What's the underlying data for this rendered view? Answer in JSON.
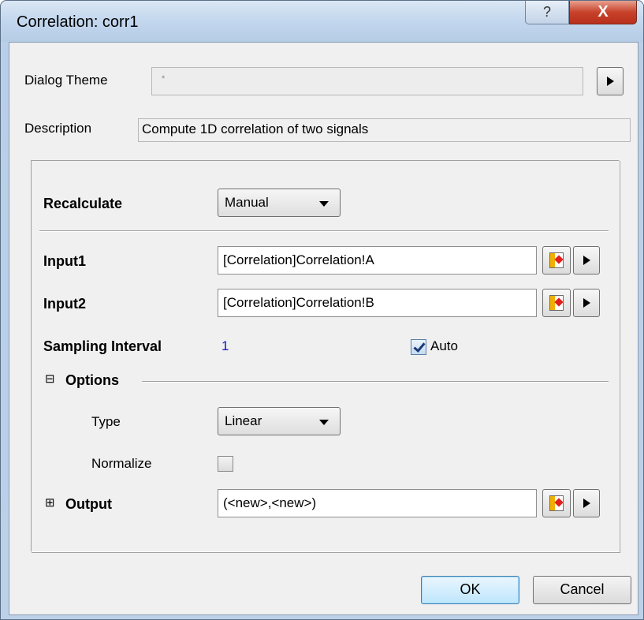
{
  "window": {
    "title": "Correlation: corr1",
    "help_label": "?",
    "close_label": "X"
  },
  "header": {
    "dialog_theme_label": "Dialog Theme",
    "dialog_theme_value": "*",
    "description_label": "Description",
    "description_value": "Compute 1D correlation of two signals"
  },
  "form": {
    "recalculate_label": "Recalculate",
    "recalculate_value": "Manual",
    "input1_label": "Input1",
    "input1_value": "[Correlation]Correlation!A",
    "input2_label": "Input2",
    "input2_value": "[Correlation]Correlation!B",
    "sampling_label": "Sampling Interval",
    "sampling_value": "1",
    "auto_label": "Auto",
    "auto_checked": true,
    "options_toggle": "⊟",
    "options_label": "Options",
    "type_label": "Type",
    "type_value": "Linear",
    "normalize_label": "Normalize",
    "normalize_checked": false,
    "output_toggle": "⊞",
    "output_label": "Output",
    "output_value": "(<new>,<new>)"
  },
  "footer": {
    "ok_label": "OK",
    "cancel_label": "Cancel"
  },
  "colors": {
    "accent": "#1414c8",
    "titlebar": "#c4d8ee",
    "close": "#c8412a"
  }
}
